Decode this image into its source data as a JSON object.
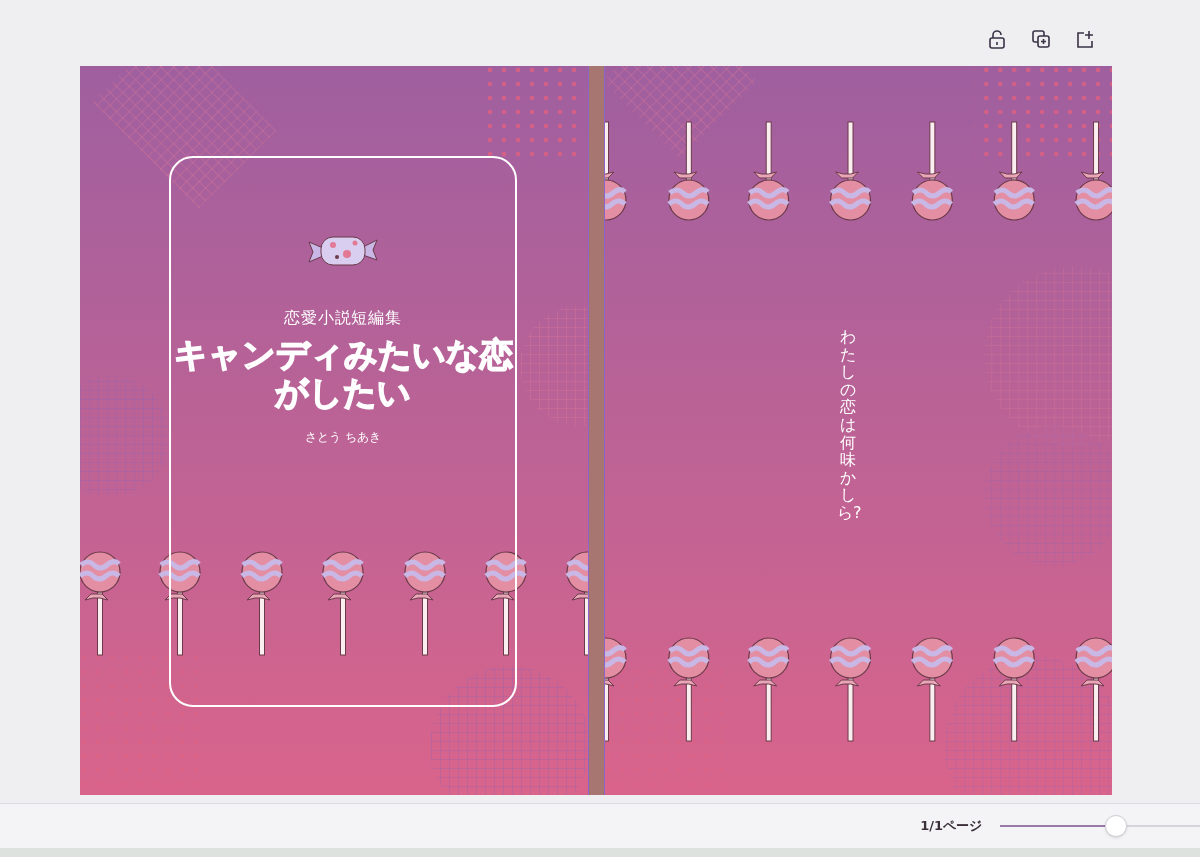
{
  "cover": {
    "series": "恋愛小説短編集",
    "title": "キャンディみたいな恋がしたい",
    "author": "さとう ちあき"
  },
  "back_cover": {
    "tagline": "わたしの恋は何味かしら?"
  },
  "footer": {
    "page_indicator": "1/1ページ",
    "zoom": {
      "level": 0.58
    }
  }
}
